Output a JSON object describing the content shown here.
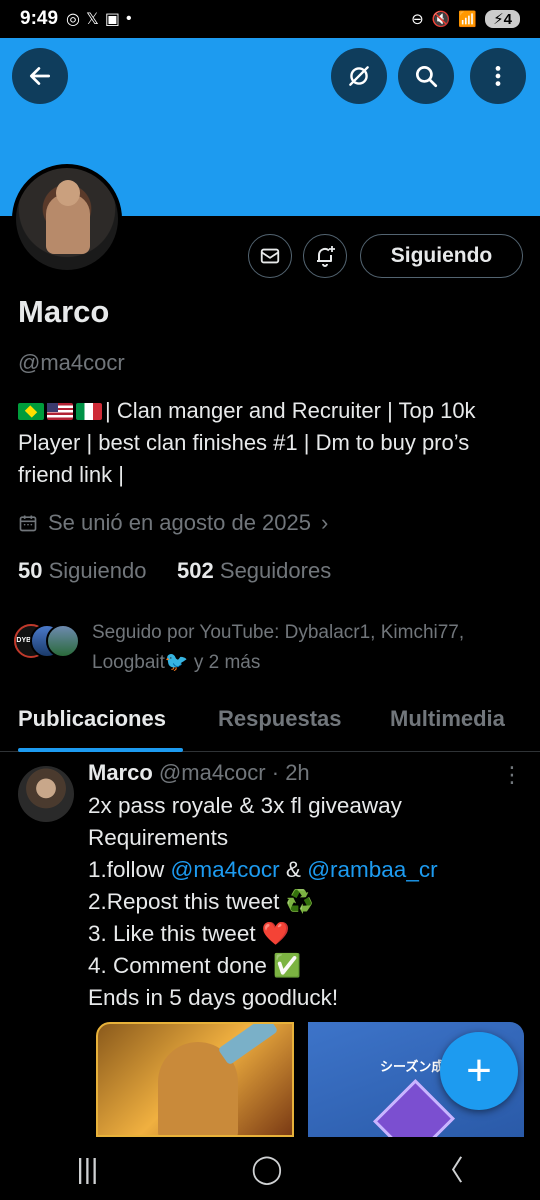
{
  "status_bar": {
    "time": "9:49",
    "battery": "4"
  },
  "profile": {
    "name": "Marco",
    "handle": "@ma4cocr",
    "bio": "| Clan manger and Recruiter | Top 10k Player | best clan finishes #1 | Dm to buy pro’s friend link |",
    "joined": "Se unió en agosto de 2025",
    "following_count": "50",
    "following_label": "Siguiendo",
    "followers_count": "502",
    "followers_label": "Seguidores",
    "follow_button": "Siguiendo",
    "followed_by": "Seguido por YouTube: Dybalacr1, Kimchi77, Loogbait",
    "followed_by_more": "y 2 más",
    "mini_avatar_label": "DYBALA"
  },
  "tabs": [
    {
      "label": "Publicaciones",
      "active": true
    },
    {
      "label": "Respuestas",
      "active": false
    },
    {
      "label": "Multimedia",
      "active": false
    }
  ],
  "tweet": {
    "author": "Marco",
    "handle": "@ma4cocr",
    "time": "· 2h",
    "line1": "2x pass royale & 3x fl giveaway",
    "line2": "Requirements",
    "line3_pre": "1.follow ",
    "mention1": "@ma4cocr",
    "line3_mid": " & ",
    "mention2": "@rambaa_cr",
    "line4": "2.Repost this tweet ♻️",
    "line5": "3. Like this tweet ❤️",
    "line6": "4. Comment done ✅",
    "line7": "Ends in 5 days goodluck!",
    "media2_caption": "シーズン成"
  },
  "colors": {
    "accent": "#1d9bf0",
    "banner": "#1d9bf0",
    "muted": "#71767b"
  },
  "icons": {
    "back": "arrow-left-icon",
    "grok": "grok-icon",
    "search": "search-icon",
    "more": "more-vertical-icon",
    "message": "mail-icon",
    "notify": "bell-plus-icon",
    "calendar": "calendar-icon",
    "compose": "plus-icon"
  }
}
